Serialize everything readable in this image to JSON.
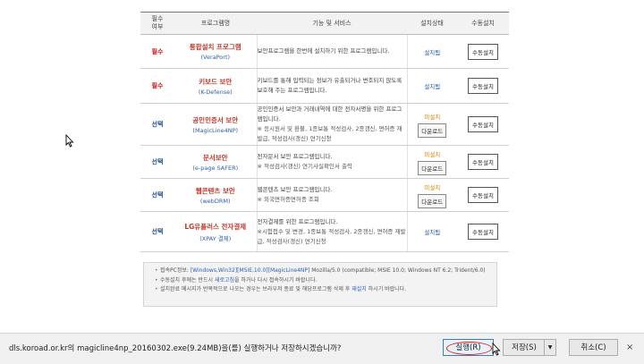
{
  "table": {
    "headers": [
      "필수\n여부",
      "프로그램명",
      "기능 및 서비스",
      "설치상태",
      "수동설치"
    ],
    "rows": [
      {
        "required": "필수",
        "name": "통합설치 프로그램",
        "module": "(VeraPort)",
        "desc": "보안프로그램을 한번에 설치하기 위한 프로그램입니다.",
        "note": "",
        "status": "설치됨",
        "download": "",
        "manual": "수동설치"
      },
      {
        "required": "필수",
        "name": "키보드 보안",
        "module": "(K-Defense)",
        "desc": "키보드를 통해 입력되는 정보가 유출되거나 변조되지 않도록 보호해 주는 프로그램입니다.",
        "note": "",
        "status": "설치됨",
        "download": "",
        "manual": "수동설치"
      },
      {
        "required": "선택",
        "name": "공인인증서 보안",
        "module": "(MagicLine4NP)",
        "desc": "공인인증서 보안과 거래내역에 대한 전자서명을 위한 프로그램입니다.",
        "note": "※ 응시원서 및 환불, 1종보통 적성검사, 2종갱신, 면허증 재발급, 적성검사(갱신) 연기신청",
        "status": "미설치",
        "download": "다운로드",
        "manual": "수동설치"
      },
      {
        "required": "선택",
        "name": "문서보안",
        "module": "(e-page SAFER)",
        "desc": "전자문서 보안 프로그램입니다.",
        "note": "※ 적성검사(갱신) 연기사실확인서 출력",
        "status": "미설치",
        "download": "다운로드",
        "manual": "수동설치"
      },
      {
        "required": "선택",
        "name": "웹콘텐츠 보안",
        "module": "(webDRM)",
        "desc": "웹콘텐츠 보안 프로그램입니다.",
        "note": "※ 외국면허증면허증 조회",
        "status": "미설치",
        "download": "다운로드",
        "manual": "수동설치"
      },
      {
        "required": "선택",
        "name": "LG유플러스 전자결제",
        "module": "(XPAY 결제)",
        "desc": "전자결제를 위한 프로그램입니다.",
        "note": "※시험접수 및 변경, 1종보통 적성검사, 2종갱신, 면허증 재발급, 적성검사(갱신) 연기신청",
        "status": "설치됨",
        "download": "",
        "manual": "수동설치"
      }
    ]
  },
  "info": {
    "env_label": "접속PC정보: ",
    "env_highlight": "[Windows,Win32][MSIE,10.0][MagicLine4NP]",
    "env_rest": " Mozilla/5.0 (compatible; MSIE 10.0; Windows NT 6.2; Trident/6.0)",
    "line2_a": "수동설치 후에는 반드시 ",
    "line2_link": "새로고침",
    "line2_b": "을 하거나 다시 접속하시기 바랍니다.",
    "line3_a": "설치완료 메시지가 반복적으로 나오는 경우는 브라우저 종료 및 해당프로그램 삭제 후 ",
    "line3_link": "재설치",
    "line3_b": " 하시기 바랍니다."
  },
  "download_bar": {
    "message": "dls.koroad.or.kr의 magicline4np_20160302.exe(9.24MB)을(를) 실행하거나 저장하시겠습니까?",
    "run": "실행(R)",
    "save": "저장(S)",
    "cancel": "취소(C)",
    "close": "×"
  },
  "colors": {
    "required_red": "#cc1111",
    "required_blue": "#1f4f88",
    "name_red": "#c0392b",
    "module_blue": "#2a62a6",
    "status_installed": "#1f5a9c",
    "status_missing": "#d08200",
    "highlight_circle": "#e02020"
  },
  "icons": {
    "cursor": "arrow-cursor-icon",
    "save_split": "triangle-down-icon",
    "close": "close-icon"
  }
}
